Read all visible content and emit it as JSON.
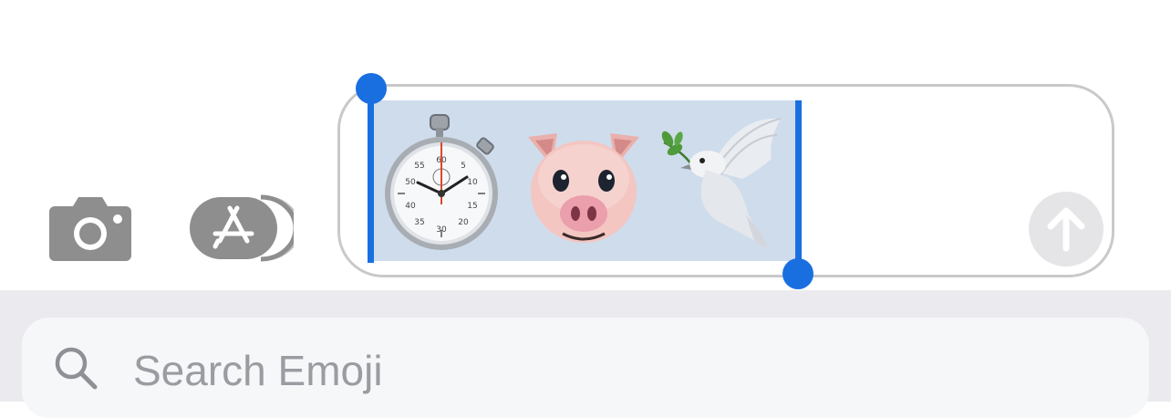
{
  "toolbar": {
    "camera_icon": "camera-icon",
    "apps_icon": "app-store-icon"
  },
  "message_field": {
    "emojis": [
      {
        "name": "stopwatch",
        "glyph": "⏱️"
      },
      {
        "name": "pig-face",
        "glyph": "🐷"
      },
      {
        "name": "dove",
        "glyph": "🕊️"
      }
    ],
    "selection": "all",
    "send_icon": "send-arrow-up-icon"
  },
  "search": {
    "placeholder": "Search Emoji",
    "icon": "search-icon"
  },
  "colors": {
    "selection_handle": "#1a6fe0",
    "selection_highlight": "#cfdcec",
    "icon_gray": "#8e8e8e",
    "keyboard_background": "#ebebef",
    "search_placeholder": "#9a9ca1"
  }
}
